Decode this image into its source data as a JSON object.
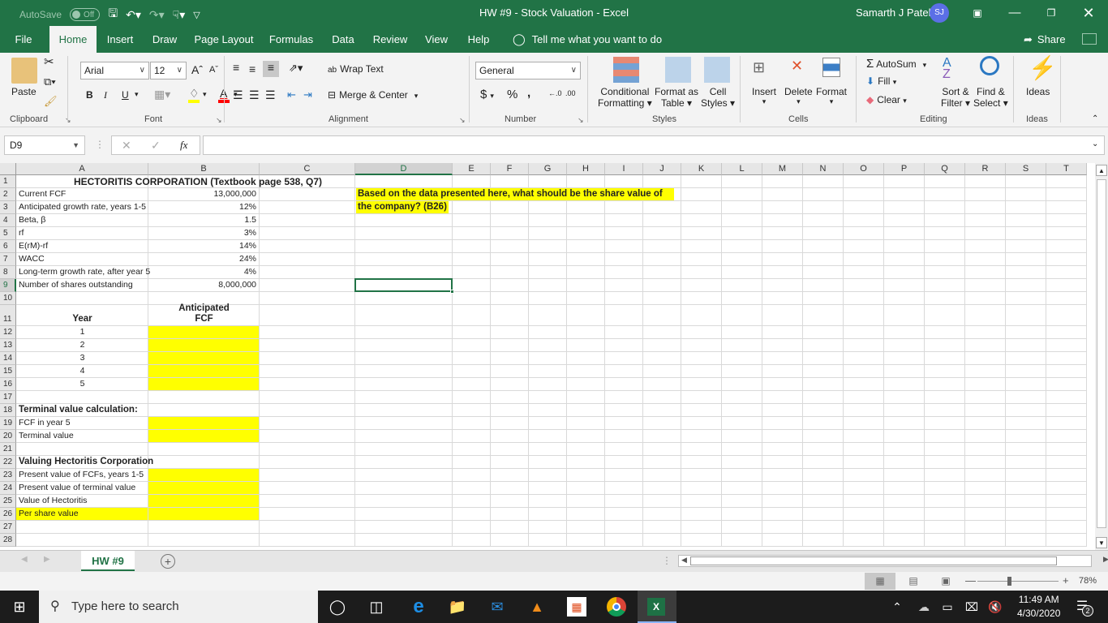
{
  "titlebar": {
    "autosave_label": "AutoSave",
    "autosave_state": "Off",
    "title": "HW #9 - Stock Valuation  -  Excel",
    "user_name": "Samarth J Patel",
    "user_initials": "SJ"
  },
  "ribbon_tabs": [
    "File",
    "Home",
    "Insert",
    "Draw",
    "Page Layout",
    "Formulas",
    "Data",
    "Review",
    "View",
    "Help"
  ],
  "active_tab": "Home",
  "tell_me": "Tell me what you want to do",
  "share_label": "Share",
  "ribbon": {
    "clipboard": {
      "paste": "Paste",
      "label": "Clipboard"
    },
    "font": {
      "name": "Arial",
      "size": "12",
      "bold": "B",
      "italic": "I",
      "underline": "U",
      "label": "Font",
      "highlight_color": "#ffff00",
      "font_color": "#ff0000"
    },
    "alignment": {
      "wrap_text": "Wrap Text",
      "merge_center": "Merge & Center",
      "label": "Alignment"
    },
    "number": {
      "format": "General",
      "currency": "$",
      "percent": "%",
      "comma": ",",
      "label": "Number"
    },
    "styles": {
      "conditional": "Conditional",
      "conditional2": "Formatting",
      "format_as": "Format as",
      "format_as2": "Table",
      "cell": "Cell",
      "cell2": "Styles",
      "label": "Styles"
    },
    "cells": {
      "insert": "Insert",
      "delete": "Delete",
      "format": "Format",
      "label": "Cells"
    },
    "editing": {
      "autosum": "AutoSum",
      "fill": "Fill",
      "clear": "Clear",
      "sort": "Sort &",
      "sort2": "Filter",
      "find": "Find &",
      "find2": "Select",
      "label": "Editing"
    },
    "ideas": {
      "button": "Ideas",
      "label": "Ideas"
    }
  },
  "formula_bar": {
    "name_box": "D9",
    "fx": "fx",
    "formula": ""
  },
  "columns": [
    "A",
    "B",
    "C",
    "D",
    "E",
    "F",
    "G",
    "H",
    "I",
    "J",
    "K",
    "L",
    "M",
    "N",
    "O",
    "P",
    "Q",
    "R",
    "S",
    "T"
  ],
  "selected_cell": "D9",
  "rows": [
    "1",
    "2",
    "3",
    "4",
    "5",
    "6",
    "7",
    "8",
    "9",
    "10",
    "11",
    "12",
    "13",
    "14",
    "15",
    "16",
    "17",
    "18",
    "19",
    "20",
    "21",
    "22",
    "23",
    "24",
    "25",
    "26",
    "27",
    "28"
  ],
  "sheet": {
    "title": "HECTORITIS CORPORATION (Textbook page 538, Q7)",
    "inputs": [
      {
        "label": "Current FCF",
        "value": "13,000,000"
      },
      {
        "label": "Anticipated growth rate, years 1-5",
        "value": "12%"
      },
      {
        "label": "Beta, β",
        "value": "1.5"
      },
      {
        "label": "rf",
        "value": "3%"
      },
      {
        "label": "E(rM)-rf",
        "value": "14%"
      },
      {
        "label": "WACC",
        "value": "24%"
      },
      {
        "label": "Long-term growth rate, after year 5",
        "value": "4%"
      },
      {
        "label": "Number of shares outstanding",
        "value": "8,000,000"
      }
    ],
    "question_line1": "Based on the data presented here, what should be the share value of",
    "question_line2": "the company? (B26)",
    "year_header": "Year",
    "fcf_header_1": "Anticipated",
    "fcf_header_2": "FCF",
    "years": [
      "1",
      "2",
      "3",
      "4",
      "5"
    ],
    "terminal_header": "Terminal value calculation:",
    "fcf_year5": "FCF in year 5",
    "terminal_value": "Terminal value",
    "valuing_header": "Valuing Hectoritis Corporation",
    "pv_fcfs": "Present value of FCFs, years 1-5",
    "pv_terminal": "Present value of terminal value",
    "value_hectoritis": "Value of Hectoritis",
    "per_share": "Per share value"
  },
  "sheet_tabs": [
    {
      "name": "HW #9",
      "active": true
    }
  ],
  "status": {
    "zoom": "78%",
    "zoom_fraction": 0.78
  },
  "taskbar": {
    "search_placeholder": "Type here to search",
    "time": "11:49 AM",
    "date": "4/30/2020",
    "notifications": "2"
  }
}
